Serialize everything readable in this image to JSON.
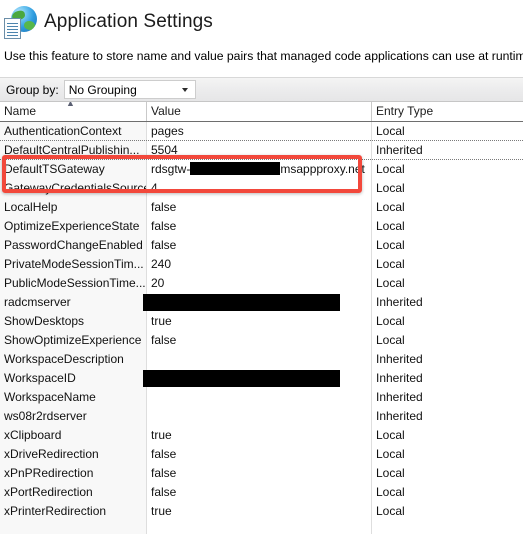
{
  "header": {
    "title": "Application Settings",
    "icon": "globe-document-icon"
  },
  "description": "Use this feature to store name and value pairs that managed code applications can use at runtime.",
  "toolbar": {
    "group_by_label": "Group by:",
    "group_by_value": "No Grouping",
    "group_by_options": [
      "No Grouping"
    ],
    "dropdown_icon": "chevron-down-icon"
  },
  "grid": {
    "columns": [
      "Name",
      "Value",
      "Entry Type"
    ],
    "sort_column": "Name",
    "sort_direction": "ascending",
    "sort_icon": "sort-ascending-icon",
    "rows": [
      {
        "name": "AuthenticationContext",
        "value": "pages",
        "entry": "Local",
        "redacted": false
      },
      {
        "name": "DefaultCentralPublishin...",
        "value": "5504",
        "entry": "Inherited",
        "redacted": false
      },
      {
        "name": "DefaultTSGateway",
        "value": "rdsgtw-████████msappproxy.net",
        "entry": "Local",
        "redacted": "partial"
      },
      {
        "name": "GatewayCredentialsSource",
        "value": "4",
        "entry": "Local",
        "redacted": false
      },
      {
        "name": "LocalHelp",
        "value": "false",
        "entry": "Local",
        "redacted": false
      },
      {
        "name": "OptimizeExperienceState",
        "value": "false",
        "entry": "Local",
        "redacted": false
      },
      {
        "name": "PasswordChangeEnabled",
        "value": "false",
        "entry": "Local",
        "redacted": false
      },
      {
        "name": "PrivateModeSessionTim...",
        "value": "240",
        "entry": "Local",
        "redacted": false
      },
      {
        "name": "PublicModeSessionTime...",
        "value": "20",
        "entry": "Local",
        "redacted": false
      },
      {
        "name": "radcmserver",
        "value": "",
        "entry": "Inherited",
        "redacted": true
      },
      {
        "name": "ShowDesktops",
        "value": "true",
        "entry": "Local",
        "redacted": false
      },
      {
        "name": "ShowOptimizeExperience",
        "value": "false",
        "entry": "Local",
        "redacted": false
      },
      {
        "name": "WorkspaceDescription",
        "value": "",
        "entry": "Inherited",
        "redacted": false
      },
      {
        "name": "WorkspaceID",
        "value": "",
        "entry": "Inherited",
        "redacted": true
      },
      {
        "name": "WorkspaceName",
        "value": "",
        "entry": "Inherited",
        "redacted": false
      },
      {
        "name": "ws08r2rdserver",
        "value": "",
        "entry": "Inherited",
        "redacted": false
      },
      {
        "name": "xClipboard",
        "value": "true",
        "entry": "Local",
        "redacted": false
      },
      {
        "name": "xDriveRedirection",
        "value": "false",
        "entry": "Local",
        "redacted": false
      },
      {
        "name": "xPnPRedirection",
        "value": "false",
        "entry": "Local",
        "redacted": false
      },
      {
        "name": "xPortRedirection",
        "value": "false",
        "entry": "Local",
        "redacted": false
      },
      {
        "name": "xPrinterRedirection",
        "value": "true",
        "entry": "Local",
        "redacted": false
      }
    ]
  },
  "annotation": {
    "type": "highlight-rectangle",
    "color": "#f2483b",
    "targets_row": "DefaultTSGateway"
  }
}
